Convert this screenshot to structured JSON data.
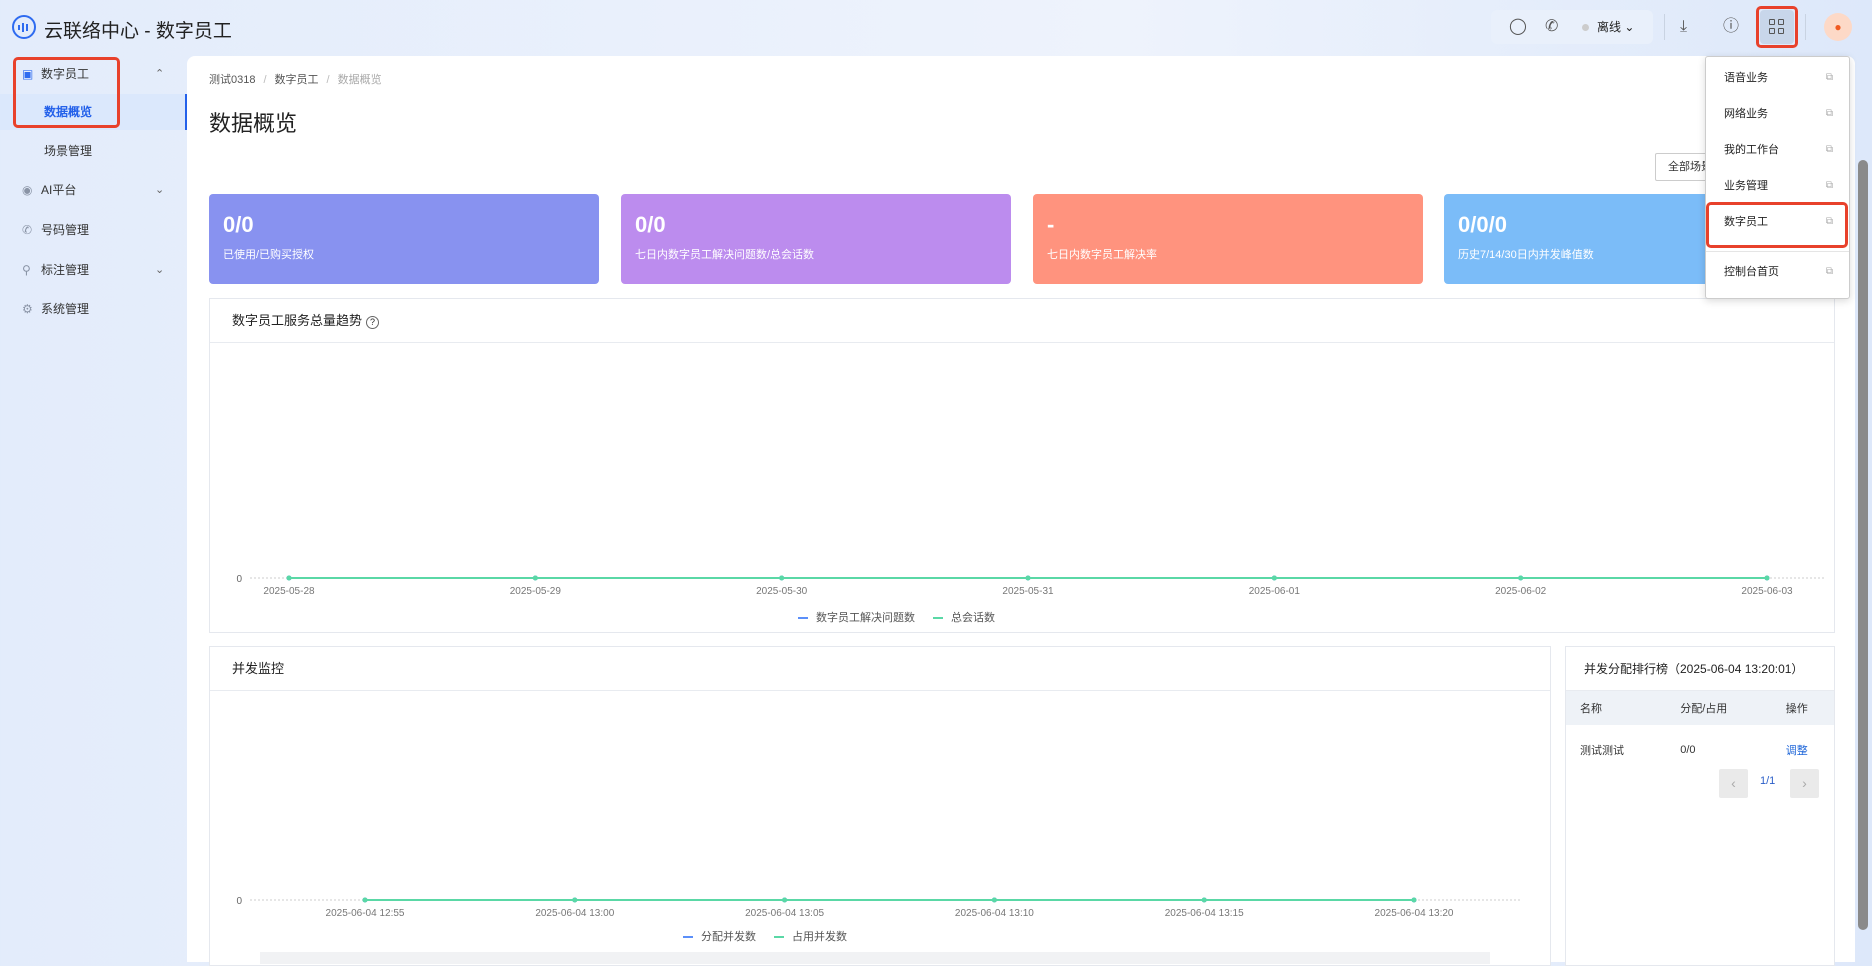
{
  "header": {
    "title": "云联络中心 - 数字员工",
    "status": "离线"
  },
  "sidebar": {
    "items": [
      {
        "label": "数字员工",
        "icon": "robot-icon",
        "expanded": true
      },
      {
        "label": "数据概览",
        "active": true
      },
      {
        "label": "场景管理"
      },
      {
        "label": "AI平台",
        "icon": "ai-icon"
      },
      {
        "label": "号码管理",
        "icon": "phone-icon"
      },
      {
        "label": "标注管理",
        "icon": "tag-icon"
      },
      {
        "label": "系统管理",
        "icon": "gear-icon"
      }
    ]
  },
  "breadcrumb": [
    "测试0318",
    "数字员工",
    "数据概览"
  ],
  "page_title": "数据概览",
  "scene_select": "全部场景",
  "cards": [
    {
      "value": "0/0",
      "label": "已使用/已购买授权",
      "color": "#8892f0"
    },
    {
      "value": "0/0",
      "label": "七日内数字员工解决问题数/总会话数",
      "color": "#bc8cee"
    },
    {
      "value": "-",
      "label": "七日内数字员工解决率",
      "color": "#ff937e"
    },
    {
      "value": "0/0/0",
      "label": "历史7/14/30日内并发峰值数",
      "color": "#7bbcf8"
    }
  ],
  "trend": {
    "title": "数字员工服务总量趋势",
    "legend": [
      "数字员工解决问题数",
      "总会话数"
    ]
  },
  "concurrency": {
    "title": "并发监控",
    "legend": [
      "分配并发数",
      "占用并发数"
    ]
  },
  "ranking": {
    "title": "并发分配排行榜（2025-06-04 13:20:01）",
    "headers": [
      "名称",
      "分配/占用",
      "操作"
    ],
    "rows": [
      {
        "name": "测试测试",
        "value": "0/0",
        "action": "调整"
      }
    ],
    "page": "1/1"
  },
  "dropdown": [
    "语音业务",
    "网络业务",
    "我的工作台",
    "业务管理",
    "数字员工",
    "控制台首页"
  ],
  "chart_data": [
    {
      "type": "line",
      "title": "数字员工服务总量趋势",
      "x": [
        "2025-05-28",
        "2025-05-29",
        "2025-05-30",
        "2025-05-31",
        "2025-06-01",
        "2025-06-02",
        "2025-06-03"
      ],
      "series": [
        {
          "name": "数字员工解决问题数",
          "values": [
            0,
            0,
            0,
            0,
            0,
            0,
            0
          ],
          "color": "#5b8ff9"
        },
        {
          "name": "总会话数",
          "values": [
            0,
            0,
            0,
            0,
            0,
            0,
            0
          ],
          "color": "#5ad8a6"
        }
      ],
      "yticks": [
        "0"
      ],
      "legend": "bottom"
    },
    {
      "type": "line",
      "title": "并发监控",
      "x": [
        "2025-06-04 12:55",
        "2025-06-04 13:00",
        "2025-06-04 13:05",
        "2025-06-04 13:10",
        "2025-06-04 13:15",
        "2025-06-04 13:20"
      ],
      "series": [
        {
          "name": "分配并发数",
          "values": [
            0,
            0,
            0,
            0,
            0,
            0
          ],
          "color": "#5b8ff9"
        },
        {
          "name": "占用并发数",
          "values": [
            0,
            0,
            0,
            0,
            0,
            0
          ],
          "color": "#5ad8a6"
        }
      ],
      "yticks": [
        "0"
      ],
      "legend": "bottom"
    }
  ]
}
